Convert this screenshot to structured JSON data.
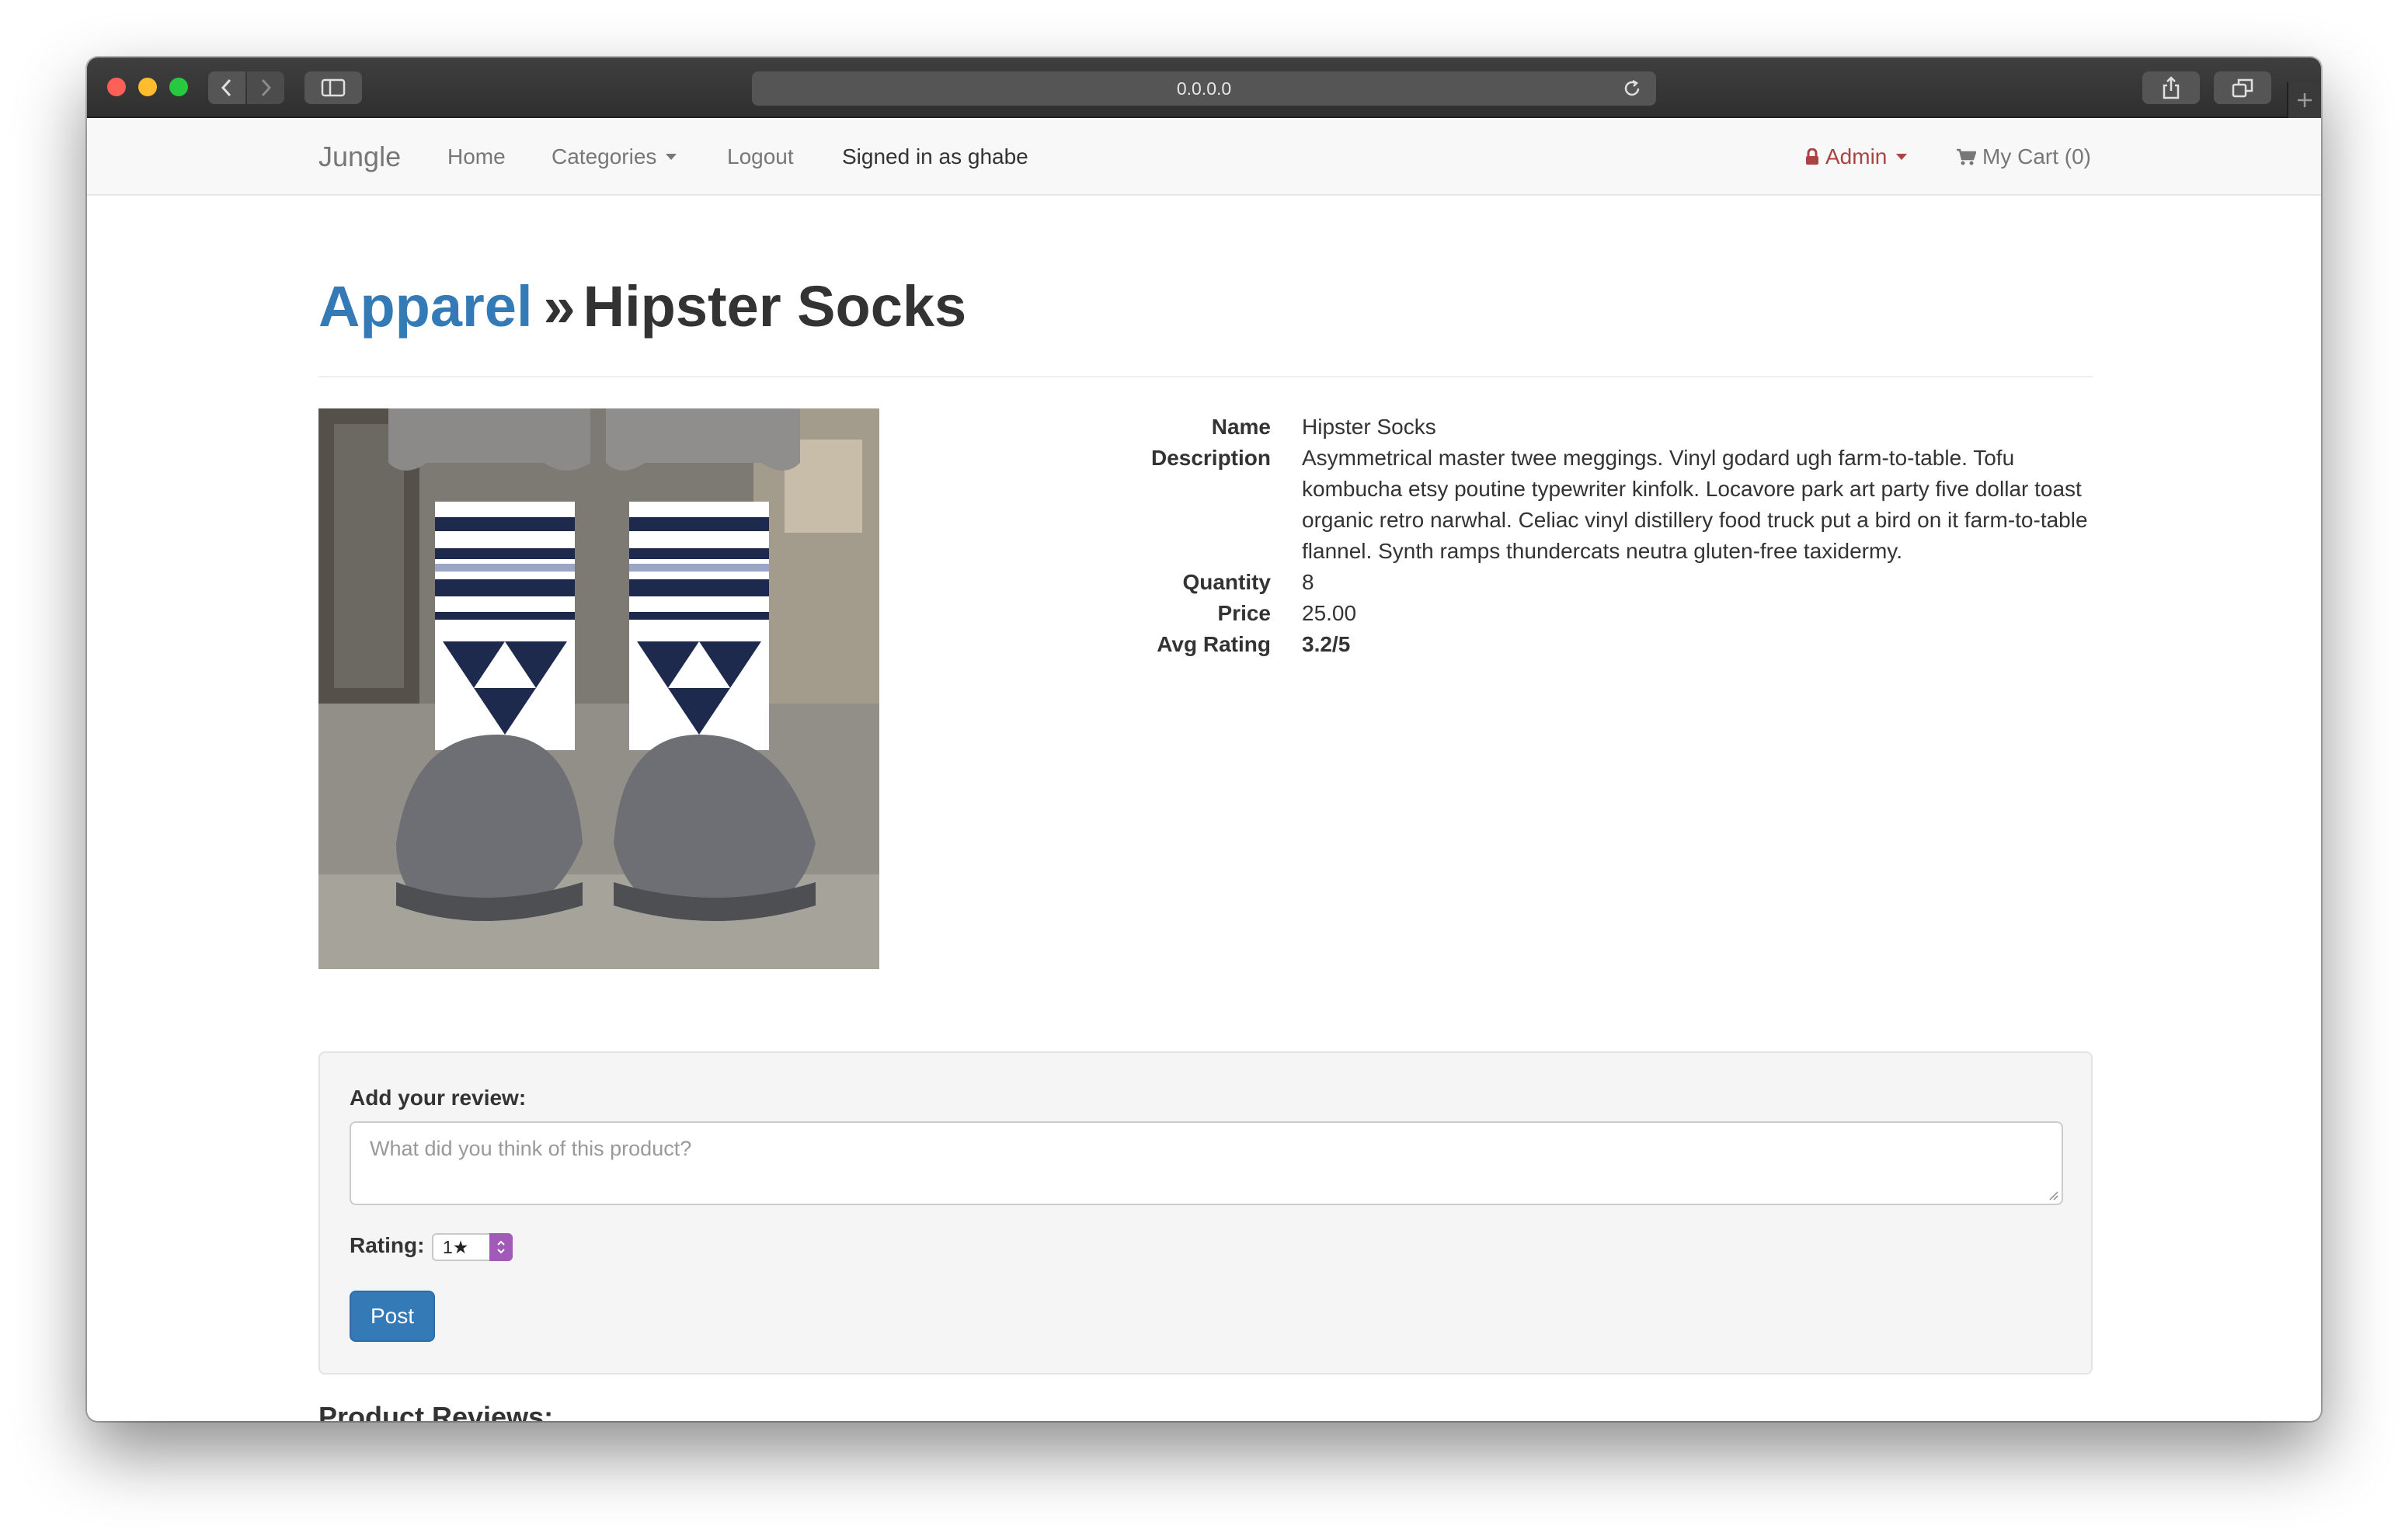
{
  "browser": {
    "address": "0.0.0.0"
  },
  "navbar": {
    "brand": "Jungle",
    "home": "Home",
    "categories": "Categories",
    "logout": "Logout",
    "signed_in": "Signed in as ghabe",
    "admin": "Admin",
    "cart": "My Cart (0)"
  },
  "page": {
    "category": "Apparel",
    "separator": "»",
    "product_title": "Hipster Socks"
  },
  "product": {
    "fields": [
      {
        "label": "Name",
        "value": "Hipster Socks"
      },
      {
        "label": "Description",
        "value": "Asymmetrical master twee meggings. Vinyl godard ugh farm-to-table. Tofu kombucha etsy poutine typewriter kinfolk. Locavore park art party five dollar toast organic retro narwhal. Celiac vinyl distillery food truck put a bird on it farm-to-table flannel. Synth ramps thundercats neutra gluten-free taxidermy."
      },
      {
        "label": "Quantity",
        "value": "8"
      },
      {
        "label": "Price",
        "value": "25.00"
      },
      {
        "label": "Avg Rating",
        "value": "3.2/5"
      }
    ]
  },
  "review_form": {
    "label": "Add your review:",
    "placeholder": "What did you think of this product?",
    "rating_label": "Rating:",
    "rating_value": "1★",
    "post_label": "Post"
  },
  "reviews": {
    "heading": "Product Reviews:"
  },
  "colors": {
    "link": "#337ab7",
    "admin": "#a94442",
    "button": "#337ab7"
  }
}
